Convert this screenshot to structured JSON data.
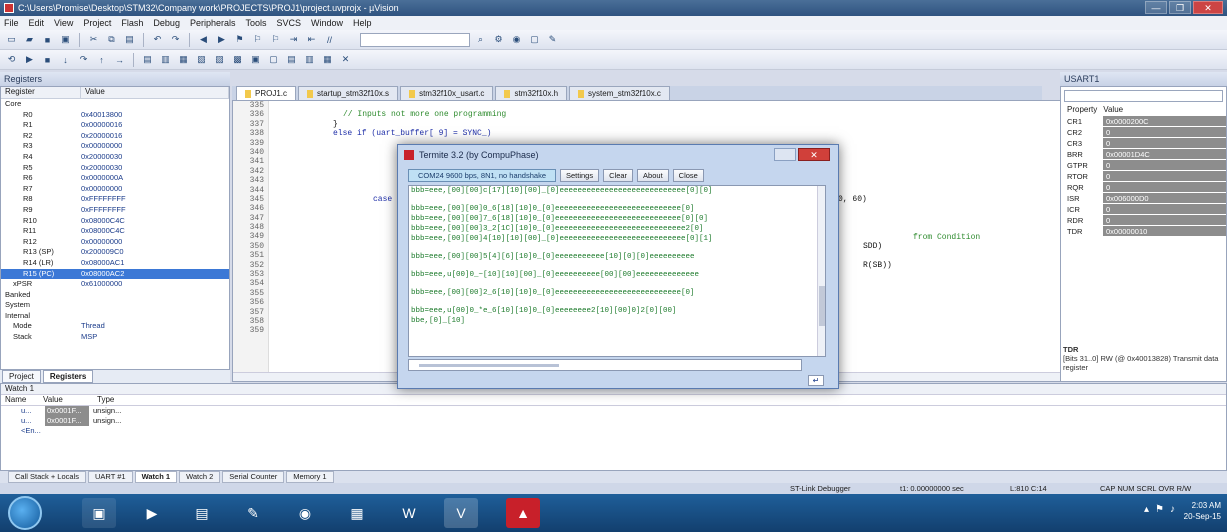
{
  "window": {
    "title": "C:\\Users\\Promise\\Desktop\\STM32\\Company work\\PROJECTS\\PROJ1\\project.uvprojx - µVision",
    "min": "—",
    "max": "❐",
    "close": "✕"
  },
  "menu": [
    "File",
    "Edit",
    "View",
    "Project",
    "Flash",
    "Debug",
    "Peripherals",
    "Tools",
    "SVCS",
    "Window",
    "Help"
  ],
  "registers": {
    "panel_title": "Registers",
    "col_register": "Register",
    "col_value": "Value",
    "rows": [
      {
        "name": "Core",
        "value": "",
        "level": 0
      },
      {
        "name": "R0",
        "value": "0x40013800",
        "level": 2
      },
      {
        "name": "R1",
        "value": "0x00000016",
        "level": 2
      },
      {
        "name": "R2",
        "value": "0x20000016",
        "level": 2
      },
      {
        "name": "R3",
        "value": "0x00000000",
        "level": 2
      },
      {
        "name": "R4",
        "value": "0x20000030",
        "level": 2
      },
      {
        "name": "R5",
        "value": "0x20000030",
        "level": 2
      },
      {
        "name": "R6",
        "value": "0x0000000A",
        "level": 2
      },
      {
        "name": "R7",
        "value": "0x00000000",
        "level": 2
      },
      {
        "name": "R8",
        "value": "0xFFFFFFFF",
        "level": 2
      },
      {
        "name": "R9",
        "value": "0xFFFFFFFF",
        "level": 2
      },
      {
        "name": "R10",
        "value": "0x08000C4C",
        "level": 2
      },
      {
        "name": "R11",
        "value": "0x08000C4C",
        "level": 2
      },
      {
        "name": "R12",
        "value": "0x00000000",
        "level": 2
      },
      {
        "name": "R13 (SP)",
        "value": "0x200009C0",
        "level": 2
      },
      {
        "name": "R14 (LR)",
        "value": "0x08000AC1",
        "level": 2
      },
      {
        "name": "R15 (PC)",
        "value": "0x08000AC2",
        "level": 2,
        "selected": true
      },
      {
        "name": "xPSR",
        "value": "0x61000000",
        "level": 1
      },
      {
        "name": "Banked",
        "value": "",
        "level": 0
      },
      {
        "name": "System",
        "value": "",
        "level": 0
      },
      {
        "name": "Internal",
        "value": "",
        "level": 0
      },
      {
        "name": "Mode",
        "value": "Thread",
        "level": 1
      },
      {
        "name": "Stack",
        "value": "MSP",
        "level": 1
      }
    ],
    "tab_project": "Project",
    "tab_registers": "Registers"
  },
  "doc_tabs": [
    "PROJ1.c",
    "startup_stm32f10x.s",
    "stm32f10x_usart.c",
    "stm32f10x.h",
    "system_stm32f10x.c"
  ],
  "editor": {
    "line_numbers": [
      "335",
      "336",
      "337",
      "338",
      "339",
      "340",
      "341",
      "342",
      "343",
      "344",
      "345",
      "346",
      "347",
      "348",
      "349",
      "350",
      "351",
      "352",
      "353",
      "354",
      "355",
      "356",
      "357",
      "358",
      "359"
    ],
    "code": [
      {
        "text": "// Inputs not more one programming",
        "kind": "cm",
        "line": 1
      },
      {
        "text": "}",
        "kind": "",
        "line": 2
      },
      {
        "text": "else if (uart_buffer[ 9] = SYNC_)",
        "kind": "kw",
        "line": 3
      },
      {
        "text": "case",
        "kind": "kw",
        "line": 10
      },
      {
        "text": "0, 60)",
        "kind": "",
        "line": 10
      },
      {
        "text": "from Condition",
        "kind": "cm",
        "line": 14
      },
      {
        "text": "SDD)",
        "kind": "",
        "line": 15
      },
      {
        "text": "R(SB))",
        "kind": "",
        "line": 17
      }
    ]
  },
  "properties": {
    "panel_title": "USART1",
    "col_property": "Property",
    "col_value": "Value",
    "rows": [
      {
        "name": "CR1",
        "value": "0x0000200C"
      },
      {
        "name": "CR2",
        "value": "0"
      },
      {
        "name": "CR3",
        "value": "0"
      },
      {
        "name": "BRR",
        "value": "0x00001D4C"
      },
      {
        "name": "GTPR",
        "value": "0"
      },
      {
        "name": "RTOR",
        "value": "0"
      },
      {
        "name": "RQR",
        "value": "0"
      },
      {
        "name": "ISR",
        "value": "0x006000D0"
      },
      {
        "name": "ICR",
        "value": "0"
      },
      {
        "name": "RDR",
        "value": "0"
      },
      {
        "name": "TDR",
        "value": "0x00000010"
      }
    ],
    "desc_title": "TDR",
    "desc_text": "[Bits 31..0] RW (@ 0x40013828) Transmit data register"
  },
  "termite": {
    "title": "Termite 3.2 (by CompuPhase)",
    "port": "COM24 9600 bps, 8N1, no handshake",
    "btn_settings": "Settings",
    "btn_clear": "Clear",
    "btn_about": "About",
    "btn_close": "Close",
    "lines": [
      "bbb=eee,[00][00]c[17][10][00]_[0]eeeeeeeeeeeeeeeeeeeeeeeeeeee[0][0]",
      "",
      "bbb=eee,[00][00]0_6[18][10]0_[0]eeeeeeeeeeeeeeeeeeeeeeeeeeee[0]",
      "bbb=eee,[00][00]7_6[18][10]0_[0]eeeeeeeeeeeeeeeeeeeeeeeeeeee[0][0]",
      "bbb=eee,[00][00]3_2[1C][10]0_[0]eeeeeeeeeeeeeeeeeeeeeeeeeeeee2[0]",
      "bbb=eee,[00][00]4[10][10][00]_[0]eeeeeeeeeeeeeeeeeeeeeeeeeeee[0][1]",
      "",
      "bbb=eee,[00][00]5[4][6][10]0_[0]eeeeeeeeeee[10][0][0]eeeeeeeeee",
      "",
      "bbb=eee,u[00]0_~[10][10][00]_[0]eeeeeeeeee[00][00]eeeeeeeeeeeeee",
      "",
      "bbb=eee,[00][00]2_6[10][10]0_[0]eeeeeeeeeeeeeeeeeeeeeeeeeeee[0]",
      "",
      "bbb=eee,u[00]0_*e_6[10][10]0_[0]eeeeeeee2[10][00]0]2[0][00]",
      "bbe,[0]_[10]"
    ],
    "send": "↵"
  },
  "watch": {
    "panel_title": "Watch 1",
    "col_name": "Name",
    "col_value": "Value",
    "col_type": "Type",
    "rows": [
      {
        "name": "u...",
        "value": "0x0001F...",
        "type": "unsign..."
      },
      {
        "name": "u...",
        "value": "0x0001F...",
        "type": "unsign..."
      },
      {
        "name": "<En...",
        "value": "",
        "type": ""
      }
    ],
    "tabs": [
      "Call Stack + Locals",
      "UART #1",
      "Watch 1",
      "Watch 2",
      "Serial Counter",
      "Memory 1"
    ]
  },
  "status": {
    "debugger": "ST-Link Debugger",
    "time": "t1: 0.00000000 sec",
    "position": "L:810 C:14",
    "caps": "CAP  NUM  SCRL  OVR  R/W"
  },
  "taskbar": {
    "time": "2:03 AM",
    "date": "20-Sep-15"
  }
}
